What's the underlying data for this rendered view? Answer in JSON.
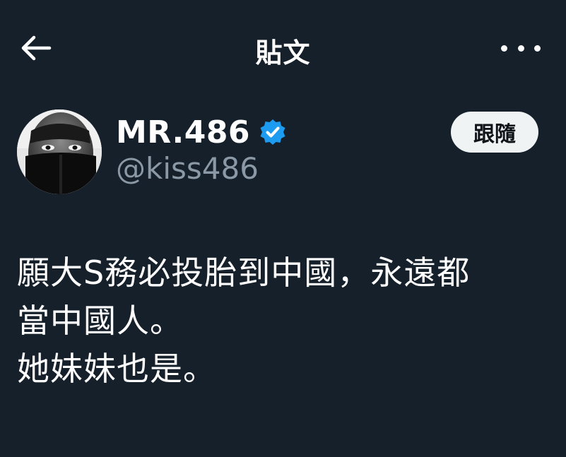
{
  "header": {
    "title": "貼文",
    "back_icon": "arrow-left-icon",
    "more_icon": "more-horizontal-icon"
  },
  "author": {
    "display_name": "MR.486",
    "handle": "@kiss486",
    "verified_icon": "verified-badge-icon",
    "verified_color": "#1d9bf0",
    "follow_label": "跟隨"
  },
  "tweet": {
    "lines": [
      "願大S務必投胎到中國，永遠都",
      "當中國人。",
      "她妹妹也是。"
    ]
  },
  "colors": {
    "background": "#15202b",
    "text_primary": "#ffffff",
    "text_secondary": "#8b98a5",
    "follow_button_bg": "#eff3f4"
  }
}
